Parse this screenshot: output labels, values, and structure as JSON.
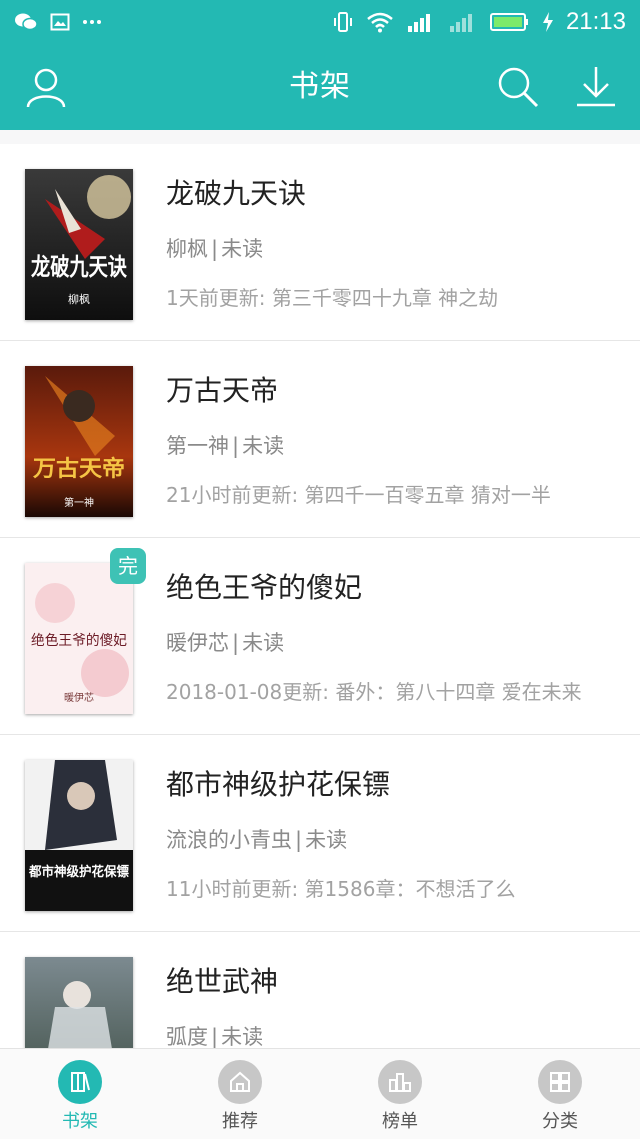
{
  "status_bar": {
    "time": "21:13"
  },
  "header": {
    "title": "书架"
  },
  "books": [
    {
      "title": "龙破九天诀",
      "author": "柳枫",
      "read_status": "未读",
      "update": "1天前更新: 第三千零四十九章 神之劫",
      "completed": false,
      "cover_text": "龙破九天诀",
      "cover_author": "柳枫"
    },
    {
      "title": "万古天帝",
      "author": "第一神",
      "read_status": "未读",
      "update": "21小时前更新: 第四千一百零五章 猜对一半",
      "completed": false,
      "cover_text": "万古天帝",
      "cover_author": "第一神"
    },
    {
      "title": "绝色王爷的傻妃",
      "author": "暖伊芯",
      "read_status": "未读",
      "update": "2018-01-08更新: 番外：第八十四章 爱在未来",
      "completed": true,
      "badge": "完",
      "cover_text": "绝色王爷的傻妃",
      "cover_author": "暖伊芯"
    },
    {
      "title": "都市神级护花保镖",
      "author": "流浪的小青虫",
      "read_status": "未读",
      "update": "11小时前更新: 第1586章：不想活了么",
      "completed": false,
      "cover_text": "都市神级护花保镖",
      "cover_author": ""
    },
    {
      "title": "绝世武神",
      "author": "弧度",
      "read_status": "未读",
      "update": "",
      "completed": false,
      "cover_text": "",
      "cover_author": ""
    }
  ],
  "tabs": [
    {
      "label": "书架",
      "active": true
    },
    {
      "label": "推荐",
      "active": false
    },
    {
      "label": "榜单",
      "active": false
    },
    {
      "label": "分类",
      "active": false
    }
  ],
  "colors": {
    "accent": "#23b9b3",
    "badge": "#3ec2b5"
  }
}
